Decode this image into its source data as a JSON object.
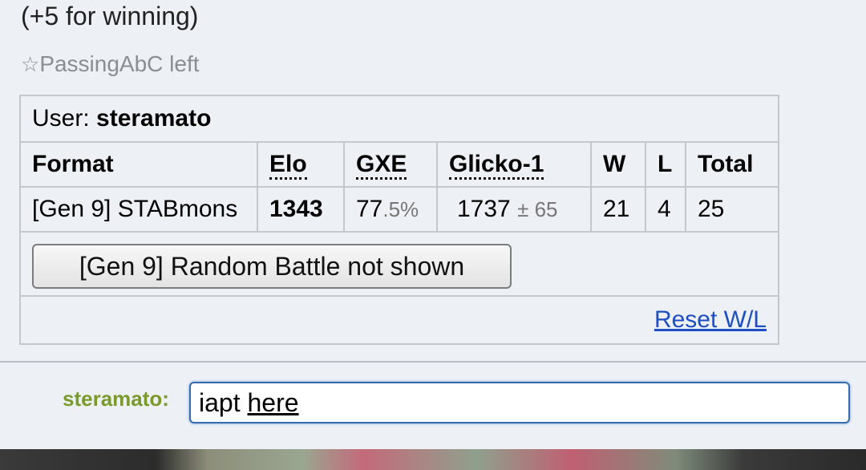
{
  "chat": {
    "win_line": "(+5 for winning)",
    "left_star": "☆",
    "left_text": "PassingAbC left"
  },
  "rank": {
    "user_label": "User: ",
    "user_name": "steramato",
    "headers": [
      "Format",
      "Elo",
      "GXE",
      "Glicko-1",
      "W",
      "L",
      "Total"
    ],
    "row": {
      "format": "[Gen 9] STABmons",
      "elo": "1343",
      "gxe_main": "77",
      "gxe_sub": ".5%",
      "glicko_main": "1737",
      "glicko_sub": "± 65",
      "w": "21",
      "l": "4",
      "total": "25"
    },
    "not_shown_button": "[Gen 9] Random Battle not shown",
    "reset_link": "Reset W/L"
  },
  "composer": {
    "name": "steramato:",
    "input_plain": "iapt ",
    "input_underlined": "here"
  }
}
